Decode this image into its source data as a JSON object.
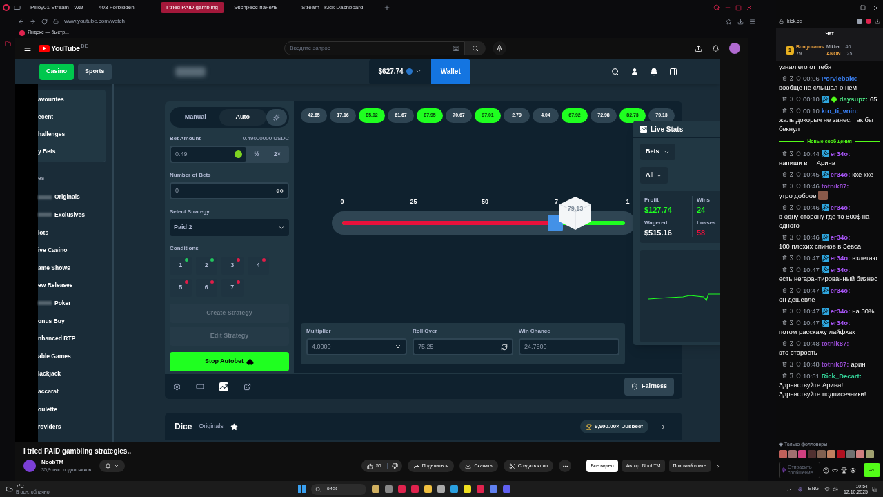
{
  "browser": {
    "tabs": [
      {
        "label": "Pilloy01 Stream - Wat",
        "selected": false
      },
      {
        "label": "403 Forbidden",
        "selected": false
      },
      {
        "label": "I tried PAID gambling",
        "selected": true
      },
      {
        "label": "Экспресс-панель",
        "selected": false
      },
      {
        "label": "Stream - Kick Dashboard",
        "selected": false
      }
    ],
    "url": "www.youtube.com/watch",
    "bookmark": "Яндекс — быстр..."
  },
  "youtube": {
    "logo": "YouTube",
    "region": "DE",
    "search_placeholder": "Введите запрос"
  },
  "casino": {
    "top_tabs": [
      {
        "label": "Casino",
        "selected": true
      },
      {
        "label": "Sports",
        "selected": false
      }
    ],
    "balance": "$627.74",
    "wallet": "Wallet",
    "sidebar": {
      "favorites": [
        {
          "label": "avourites"
        },
        {
          "label": "ecent"
        },
        {
          "label": "hallenges"
        },
        {
          "label": "y Bets"
        }
      ],
      "categories": [
        {
          "label": "es",
          "kind": "heading",
          "redacted": false
        },
        {
          "label": "Originals",
          "kind": "item",
          "redacted": true
        },
        {
          "label": "Exclusives",
          "kind": "item",
          "redacted": true
        },
        {
          "label": "lots",
          "kind": "item",
          "redacted": false
        },
        {
          "label": "ive Casino",
          "kind": "item",
          "redacted": false
        },
        {
          "label": "ame Shows",
          "kind": "item",
          "redacted": false
        },
        {
          "label": "ew Releases",
          "kind": "item",
          "redacted": false
        },
        {
          "label": "Poker",
          "kind": "item",
          "redacted": true
        },
        {
          "label": "onus Buy",
          "kind": "item",
          "redacted": false
        },
        {
          "label": "nhanced RTP",
          "kind": "item",
          "redacted": false
        },
        {
          "label": "able Games",
          "kind": "item",
          "redacted": false
        },
        {
          "label": "lackjack",
          "kind": "item",
          "redacted": false
        },
        {
          "label": "accarat",
          "kind": "item",
          "redacted": false
        },
        {
          "label": "oulette",
          "kind": "item",
          "redacted": false
        },
        {
          "label": "roviders",
          "kind": "item",
          "redacted": false
        }
      ]
    },
    "bet_panel": {
      "modes": [
        {
          "label": "Manual",
          "selected": false
        },
        {
          "label": "Auto",
          "selected": true
        }
      ],
      "bet_amount_label": "Bet Amount",
      "bet_amount_value": "0.49000000 USDC",
      "bet": "0.49",
      "half": "½",
      "double": "2×",
      "bets_label": "Number of Bets",
      "bets": "0",
      "strategy_label": "Select Strategy",
      "strategy": "Paid 2",
      "conditions_label": "Conditions",
      "conditions": [
        {
          "label": "1",
          "color": "#22c55e"
        },
        {
          "label": "2",
          "color": "#22c55e"
        },
        {
          "label": "3",
          "color": "#e11d48"
        },
        {
          "label": "4",
          "color": "#e11d48"
        },
        {
          "label": "5",
          "color": "#e11d48"
        },
        {
          "label": "6",
          "color": "#e11d48"
        },
        {
          "label": "7",
          "color": "#e11d48"
        }
      ],
      "buttons": [
        {
          "label": "Create Strategy",
          "kind": "secondary"
        },
        {
          "label": "Edit Strategy",
          "kind": "secondary"
        },
        {
          "label": "Stop Autobet",
          "kind": "primary"
        }
      ]
    },
    "results": [
      {
        "value": "42.65",
        "win": false
      },
      {
        "value": "17.16",
        "win": false
      },
      {
        "value": "85.02",
        "win": true
      },
      {
        "value": "61.67",
        "win": false
      },
      {
        "value": "87.95",
        "win": true
      },
      {
        "value": "70.67",
        "win": false
      },
      {
        "value": "97.01",
        "win": true
      },
      {
        "value": "2.79",
        "win": false
      },
      {
        "value": "4.04",
        "win": false
      },
      {
        "value": "67.92",
        "win": true
      },
      {
        "value": "72.98",
        "win": false
      },
      {
        "value": "82.73",
        "win": true
      },
      {
        "value": "79.13",
        "win": false
      }
    ],
    "slider": {
      "ticks": [
        "0",
        "25",
        "50",
        "7",
        "1"
      ],
      "level": 0.7525,
      "result": "79.13"
    },
    "fields": [
      {
        "label": "Multiplier",
        "value": "4.0000",
        "kind": "clear"
      },
      {
        "label": "Roll Over",
        "value": "75.25",
        "kind": "swap"
      },
      {
        "label": "Win Chance",
        "value": "24.7500",
        "kind": "plain"
      }
    ],
    "live_stats": {
      "title": "Live Stats",
      "filter_1": "Bets",
      "filter_2": "All",
      "profit_label": "Profit",
      "profit": "$127.74",
      "wagered_label": "Wagered",
      "wagered": "$515.16",
      "wins_label": "Wins",
      "wins": "24",
      "losses_label": "Losses",
      "losses": "58"
    },
    "fairness": "Fairness",
    "game": {
      "title": "Dice",
      "category": "Originals",
      "record_multiplier": "9,900.00×",
      "record_user": "Jusbeef"
    }
  },
  "video": {
    "title": "I tried PAID gambling strategies..",
    "channel": "NoobTM",
    "subscribers": "35,9 тыс. подписчиков",
    "likes": "56",
    "actions": [
      "Поделиться",
      "Скачать",
      "Создать клип"
    ],
    "chips": [
      {
        "label": "Все видео",
        "selected": true
      },
      {
        "label": "Автор: NoobTM",
        "selected": false
      },
      {
        "label": "Похожий конте",
        "selected": false
      }
    ]
  },
  "chat": {
    "url": "kick.cc",
    "title": "Чат",
    "leaders": [
      {
        "rank": "1",
        "name": "Bongocams",
        "count": "79"
      },
      {
        "name": "Mikha...",
        "count": "40"
      },
      {
        "name": "ANON...",
        "count": "25"
      }
    ],
    "messages": [
      {
        "kind": "cut",
        "text": "узнал его от тебя"
      },
      {
        "kind": "message",
        "time": "00:06",
        "user": "Porviebalo:",
        "color": "#3b82f6",
        "moderator": false,
        "diamond": false,
        "emote": false,
        "text": "вообще не слышал о нем"
      },
      {
        "kind": "message",
        "time": "00:10",
        "user": "daysupz:",
        "color": "#4ade80",
        "moderator": true,
        "diamond": true,
        "emote": false,
        "text": "65"
      },
      {
        "kind": "message",
        "time": "00:10",
        "user": "kto_ti_voin:",
        "color": "#3b82f6",
        "moderator": false,
        "diamond": false,
        "emote": false,
        "text": "жаль докорыч не занес. так бы бекнул"
      },
      {
        "kind": "divider",
        "text": "Новые сообщения"
      },
      {
        "kind": "message",
        "time": "10:44",
        "user": "er34o:",
        "color": "#a855f7",
        "moderator": true,
        "diamond": false,
        "emote": false,
        "text": "напиши в тг Арина"
      },
      {
        "kind": "message",
        "time": "10:45",
        "user": "er34o:",
        "color": "#a855f7",
        "moderator": true,
        "diamond": false,
        "emote": false,
        "text": "кхе кхе"
      },
      {
        "kind": "message",
        "time": "10:46",
        "user": "totnik87:",
        "color": "#9b4dd6",
        "moderator": false,
        "diamond": false,
        "emote": true,
        "text": "утро доброе"
      },
      {
        "kind": "message",
        "time": "10:46",
        "user": "er34o:",
        "color": "#a855f7",
        "moderator": true,
        "diamond": false,
        "emote": false,
        "text": "в одну сторону где то 800$ на одного"
      },
      {
        "kind": "message",
        "time": "10:46",
        "user": "er34o:",
        "color": "#a855f7",
        "moderator": true,
        "diamond": false,
        "emote": false,
        "text": "100 плохих спинов в Зевса"
      },
      {
        "kind": "message",
        "time": "10:47",
        "user": "er34o:",
        "color": "#a855f7",
        "moderator": true,
        "diamond": false,
        "emote": false,
        "text": "взлетаю"
      },
      {
        "kind": "message",
        "time": "10:47",
        "user": "er34o:",
        "color": "#a855f7",
        "moderator": true,
        "diamond": false,
        "emote": false,
        "text": "есть негарантированный бизнес"
      },
      {
        "kind": "message",
        "time": "10:47",
        "user": "er34o:",
        "color": "#a855f7",
        "moderator": true,
        "diamond": false,
        "emote": false,
        "text": "он дешевле"
      },
      {
        "kind": "message",
        "time": "10:47",
        "user": "er34o:",
        "color": "#a855f7",
        "moderator": true,
        "diamond": false,
        "emote": false,
        "text": "на 30%"
      },
      {
        "kind": "message",
        "time": "10:47",
        "user": "er34o:",
        "color": "#a855f7",
        "moderator": true,
        "diamond": false,
        "emote": false,
        "text": "потом расскажу лайфхак"
      },
      {
        "kind": "message",
        "time": "10:48",
        "user": "totnik87:",
        "color": "#9b4dd6",
        "moderator": false,
        "diamond": false,
        "emote": false,
        "text": "это старость"
      },
      {
        "kind": "message",
        "time": "10:48",
        "user": "totnik87:",
        "color": "#9b4dd6",
        "moderator": false,
        "diamond": false,
        "emote": false,
        "text": "арин"
      },
      {
        "kind": "message",
        "time": "10:51",
        "user": "Rick_Decart:",
        "color": "#34d399",
        "moderator": false,
        "diamond": false,
        "emote": false,
        "text": "Здравствуйте Арина! Здравствуйте подписечники!"
      }
    ],
    "followers_only": "Только фолловеры",
    "placeholder": "Отправить сообщение",
    "send": "Чат"
  },
  "taskbar": {
    "temp": "7°C",
    "weather": "В осн. облачно",
    "search": "Поиск",
    "lang": "ENG",
    "time": "10:54",
    "date": "12.10.2025"
  }
}
